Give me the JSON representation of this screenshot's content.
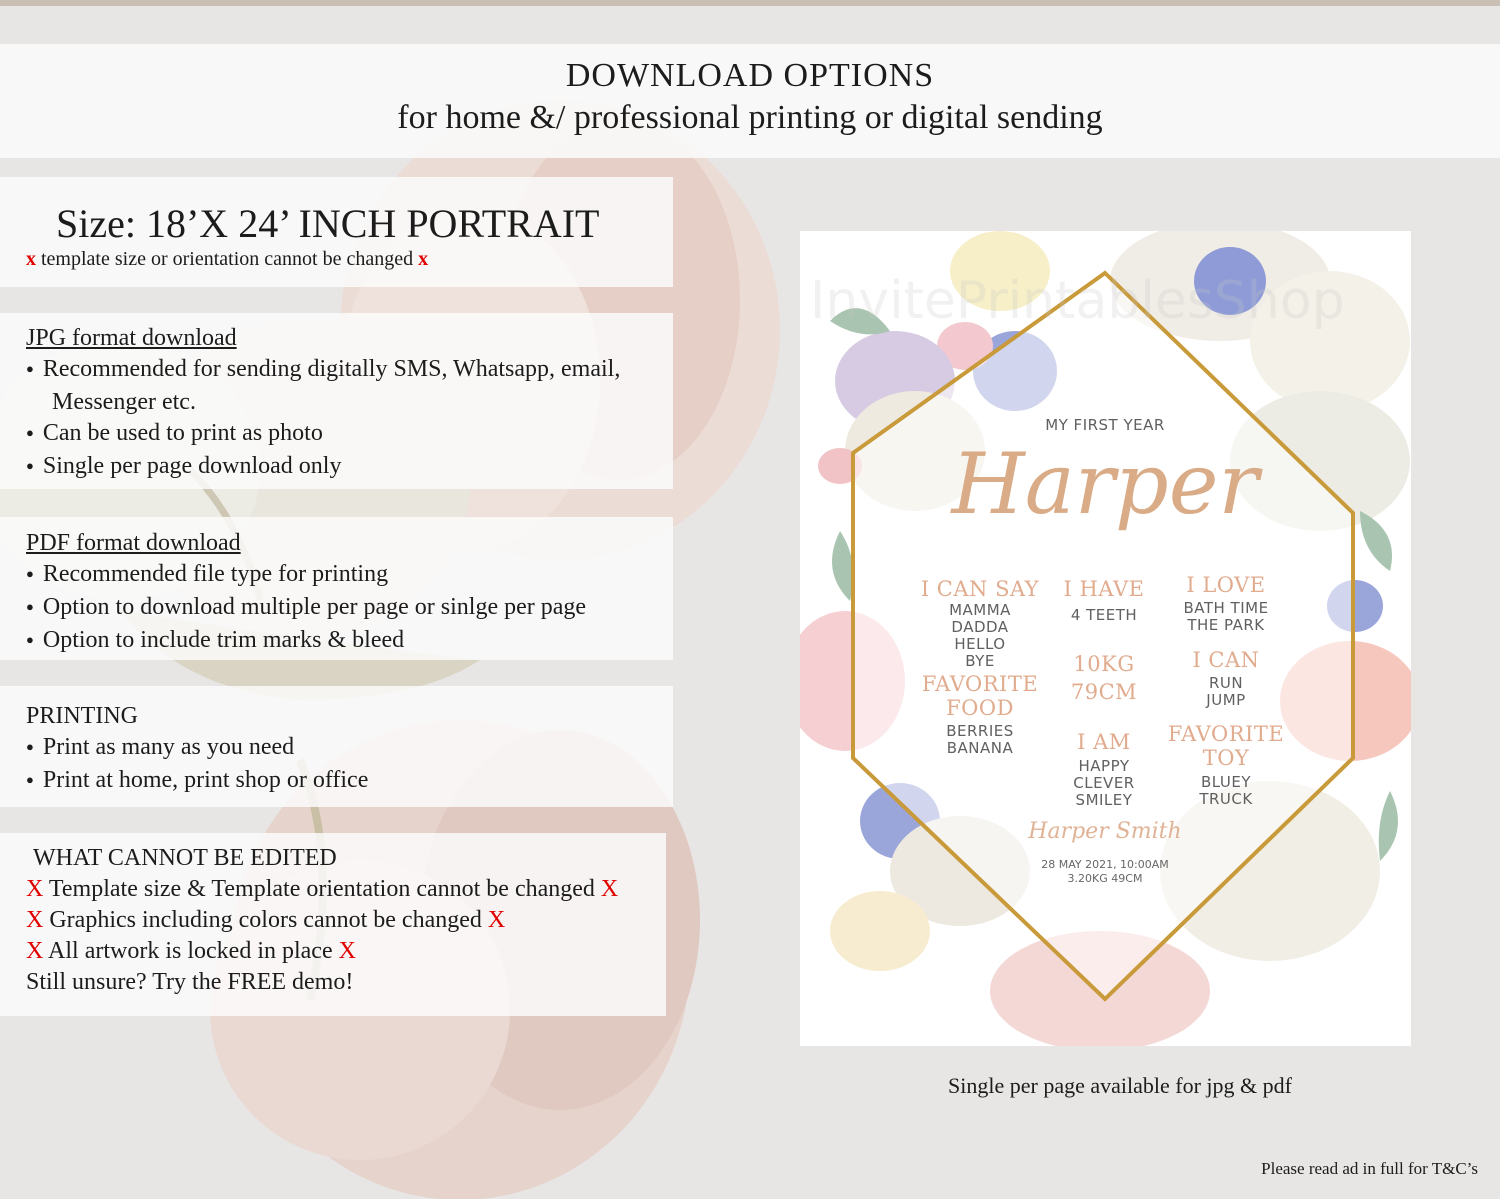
{
  "header": {
    "title": "DOWNLOAD OPTIONS",
    "subtitle": "for home &/ professional printing or digital sending"
  },
  "size": {
    "title": "Size: 18’X 24’ INCH PORTRAIT",
    "note": "template size or orientation cannot be changed",
    "mark": "x"
  },
  "jpg": {
    "title": "JPG format download",
    "items": [
      "Recommended for sending digitally SMS, Whatsapp, email,",
      "Messenger etc.",
      "Can be used to print as photo",
      "Single per page download only"
    ]
  },
  "pdf": {
    "title": "PDF format download",
    "items": [
      "Recommended file type for printing",
      "Option to download multiple per page or sinlge per page",
      "Option to include trim marks & bleed"
    ]
  },
  "printing": {
    "title": "PRINTING",
    "items": [
      "Print as many as you need",
      "Print at home, print shop or office"
    ]
  },
  "cannot_edit": {
    "title": "WHAT CANNOT BE EDITED",
    "mark": "X",
    "items": [
      "Template size & Template orientation cannot be changed",
      "Graphics including colors cannot be changed",
      "All artwork is locked in place"
    ],
    "demo": "Still unsure? Try the FREE demo!"
  },
  "poster": {
    "watermark": "InvitePrintablesShop",
    "first_year": "MY FIRST YEAR",
    "name": "Harper",
    "can_say_title": "I CAN SAY",
    "can_say": [
      "MAMMA",
      "DADDA",
      "HELLO",
      "BYE"
    ],
    "have_title": "I HAVE",
    "have": "4 TEETH",
    "love_title": "I LOVE",
    "love": [
      "BATH TIME",
      "THE PARK"
    ],
    "weight": "10KG",
    "height": "79CM",
    "can_title": "I CAN",
    "can": [
      "RUN",
      "JUMP"
    ],
    "food_title": [
      "FAVORITE",
      "FOOD"
    ],
    "food": [
      "BERRIES",
      "BANANA"
    ],
    "am_title": "I AM",
    "am": [
      "HAPPY",
      "CLEVER",
      "SMILEY"
    ],
    "toy_title": [
      "FAVORITE",
      "TOY"
    ],
    "toy": [
      "BLUEY",
      "TRUCK"
    ],
    "signature": "Harper Smith",
    "birth_line1": "28 MAY 2021, 10:00AM",
    "birth_line2": "3.20KG 49CM"
  },
  "caption": "Single per page available for jpg & pdf",
  "footnote": "Please read ad in full for T&C’s",
  "colors": {
    "accent_red": "#e00000",
    "poster_peach": "#e1ab8e",
    "frame_gold": "#c99a3a"
  }
}
